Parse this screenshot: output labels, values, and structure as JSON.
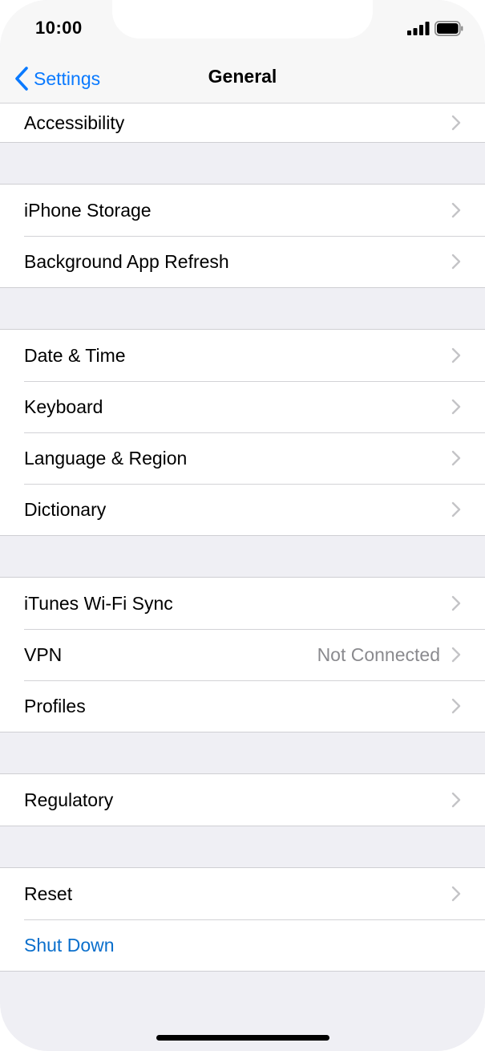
{
  "status_bar": {
    "time": "10:00"
  },
  "nav": {
    "back_label": "Settings",
    "title": "General"
  },
  "groups": [
    [
      {
        "label": "Accessibility"
      }
    ],
    [
      {
        "label": "iPhone Storage"
      },
      {
        "label": "Background App Refresh"
      }
    ],
    [
      {
        "label": "Date & Time"
      },
      {
        "label": "Keyboard"
      },
      {
        "label": "Language & Region"
      },
      {
        "label": "Dictionary"
      }
    ],
    [
      {
        "label": "iTunes Wi-Fi Sync"
      },
      {
        "label": "VPN",
        "value": "Not Connected"
      },
      {
        "label": "Profiles"
      }
    ],
    [
      {
        "label": "Regulatory"
      }
    ],
    [
      {
        "label": "Reset"
      },
      {
        "label": "Shut Down"
      }
    ]
  ],
  "colors": {
    "accent": "#0a7aff",
    "destructive_blue": "#0a6fcc",
    "background": "#efeff4"
  }
}
